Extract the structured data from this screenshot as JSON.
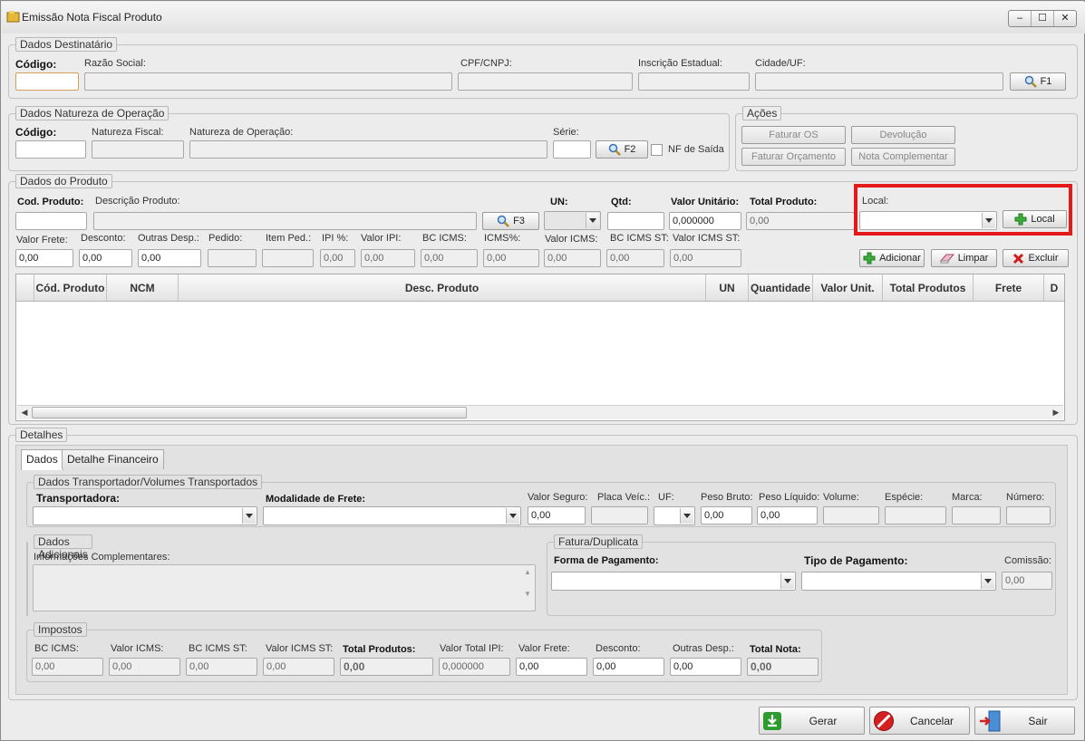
{
  "window": {
    "title": "Emissão Nota Fiscal Produto",
    "controls": [
      "–",
      "☐",
      "✕"
    ]
  },
  "destinatario": {
    "title": "Dados Destinatário",
    "codigo": "Código:",
    "razao": "Razão Social:",
    "cpf": "CPF/CNPJ:",
    "ie": "Inscrição Estadual:",
    "cidade": "Cidade/UF:",
    "btn": "F1"
  },
  "natureza": {
    "title": "Dados Natureza de Operação",
    "codigo": "Código:",
    "fiscal": "Natureza Fiscal:",
    "operacao": "Natureza de Operação:",
    "serie": "Série:",
    "btn": "F2",
    "nf_saida": "NF de Saída"
  },
  "acoes": {
    "title": "Ações",
    "faturar_os": "Faturar OS",
    "devolucao": "Devolução",
    "faturar_orc": "Faturar Orçamento",
    "nota_comp": "Nota Complementar"
  },
  "produto": {
    "title": "Dados do Produto",
    "cod": "Cod. Produto:",
    "desc": "Descrição Produto:",
    "btn": "F3",
    "un": "UN:",
    "qtd": "Qtd:",
    "vunit": "Valor Unitário:",
    "vunit_val": "0,000000",
    "total": "Total Produto:",
    "total_val": "0,00",
    "local": "Local:",
    "local_btn": "Local",
    "frete": "Valor Frete:",
    "frete_val": "0,00",
    "desconto": "Desconto:",
    "desconto_val": "0,00",
    "outras": "Outras Desp.:",
    "outras_val": "0,00",
    "pedido": "Pedido:",
    "item": "Item Ped.:",
    "ipi": "IPI %:",
    "ipi_val": "0,00",
    "vipi": "Valor IPI:",
    "vipi_val": "0,00",
    "bcicms": "BC ICMS:",
    "bcicms_val": "0,00",
    "icms": "ICMS%:",
    "icms_val": "0,00",
    "vicms": "Valor ICMS:",
    "vicms_val": "0,00",
    "bcst": "BC ICMS ST:",
    "bcst_val": "0,00",
    "vst": "Valor ICMS ST:",
    "vst_val": "0,00",
    "adicionar": "Adicionar",
    "limpar": "Limpar",
    "excluir": "Excluir"
  },
  "grid": {
    "columns": [
      "Cód. Produto",
      "NCM",
      "Desc. Produto",
      "UN",
      "Quantidade",
      "Valor Unit.",
      "Total Produtos",
      "Frete",
      "D"
    ]
  },
  "detalhes": {
    "title": "Detalhes",
    "tab1": "Dados",
    "tab2": "Detalhe Financeiro"
  },
  "transp": {
    "title": "Dados Transportador/Volumes Transportados",
    "transportadora": "Transportadora:",
    "modalidade": "Modalidade de Frete:",
    "vseguro": "Valor Seguro:",
    "vseguro_val": "0,00",
    "placa": "Placa Veíc.:",
    "uf": "UF:",
    "pbruto": "Peso Bruto:",
    "pbruto_val": "0,00",
    "pliq": "Peso Líquido:",
    "pliq_val": "0,00",
    "volume": "Volume:",
    "especie": "Espécie:",
    "marca": "Marca:",
    "numero": "Número:"
  },
  "adicionais": {
    "title": "Dados Adicionais",
    "info": "Informações Complementares:"
  },
  "fatura": {
    "title": "Fatura/Duplicata",
    "forma": "Forma de Pagamento:",
    "tipo": "Tipo de Pagamento:",
    "comissao": "Comissão:",
    "comissao_val": "0,00"
  },
  "impostos": {
    "title": "Impostos",
    "bc": "BC ICMS:",
    "bc_val": "0,00",
    "vicms": "Valor ICMS:",
    "vicms_val": "0,00",
    "bcst": "BC ICMS ST:",
    "bcst_val": "0,00",
    "vst": "Valor ICMS ST:",
    "vst_val": "0,00",
    "tprod": "Total Produtos:",
    "tprod_val": "0,00",
    "vipi": "Valor Total IPI:",
    "vipi_val": "0,000000",
    "frete": "Valor Frete:",
    "frete_val": "0,00",
    "desc": "Desconto:",
    "desc_val": "0,00",
    "outras": "Outras Desp.:",
    "outras_val": "0,00",
    "tnota": "Total Nota:",
    "tnota_val": "0,00"
  },
  "footer": {
    "gerar": "Gerar",
    "cancelar": "Cancelar",
    "sair": "Sair"
  },
  "colors": {
    "highlight": "#e41a1a",
    "add": "#2e9b2e",
    "delete": "#d11a1a"
  }
}
